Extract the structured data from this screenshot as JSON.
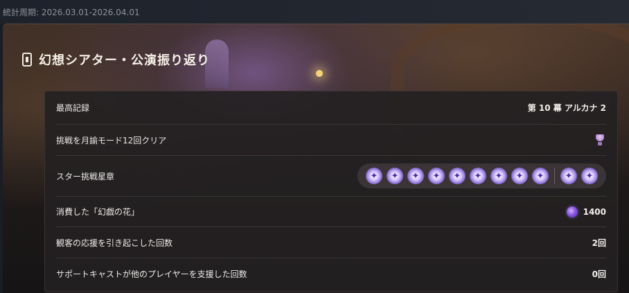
{
  "header": {
    "period_label": "統計周期: 2026.03.01-2026.04.01"
  },
  "panel": {
    "title": "幻想シアター・公演振り返り",
    "title_icon": "card-icon"
  },
  "rows": [
    {
      "label": "最高記録",
      "value": "第 10 幕  アルカナ 2"
    },
    {
      "label": "挑戦を月諭モード12回クリア",
      "value_icon": "trophy-icon"
    },
    {
      "label": "スター挑戦星章",
      "star_count": 11
    },
    {
      "label": "消費した「幻戯の花」",
      "value": "1400",
      "value_icon": "flower-icon"
    },
    {
      "label": "観客の応援を引き起こした回数",
      "value": "2回"
    },
    {
      "label": "サポートキャストが他のプレイヤーを支援した回数",
      "value": "0回"
    }
  ],
  "colors": {
    "accent_star": "#7d62c9",
    "text": "#f2f0ec"
  }
}
